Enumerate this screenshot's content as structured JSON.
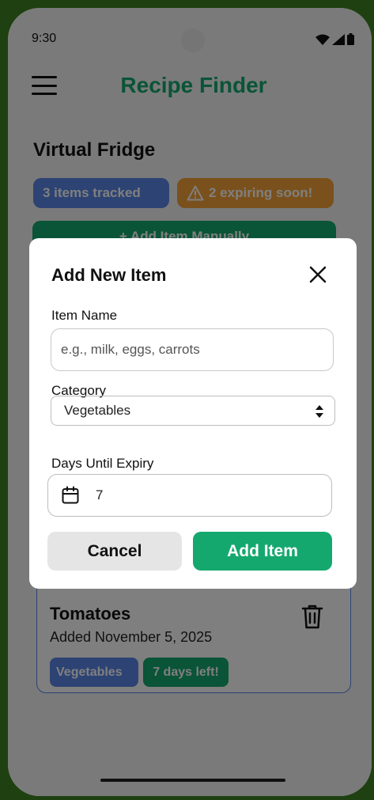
{
  "status_bar": {
    "time": "9:30"
  },
  "header": {
    "title": "Recipe Finder"
  },
  "fridge": {
    "title": "Virtual Fridge",
    "tracked_badge": "3 items tracked",
    "expiring_badge": "2 expiring soon!",
    "add_manual_label": "+ Add Item Manually"
  },
  "item": {
    "name": "Tomatoes",
    "added": "Added November 5, 2025",
    "category": "Vegetables",
    "expiry": "7 days left!"
  },
  "modal": {
    "title": "Add New Item",
    "name_label": "Item Name",
    "name_placeholder": "e.g., milk, eggs, carrots",
    "category_label": "Category",
    "category_value": "Vegetables",
    "expiry_label": "Days Until Expiry",
    "expiry_value": "7",
    "cancel_label": "Cancel",
    "add_label": "Add Item"
  },
  "colors": {
    "accent": "#14a86f",
    "blue": "#5a86e8",
    "orange": "#f5a238"
  }
}
